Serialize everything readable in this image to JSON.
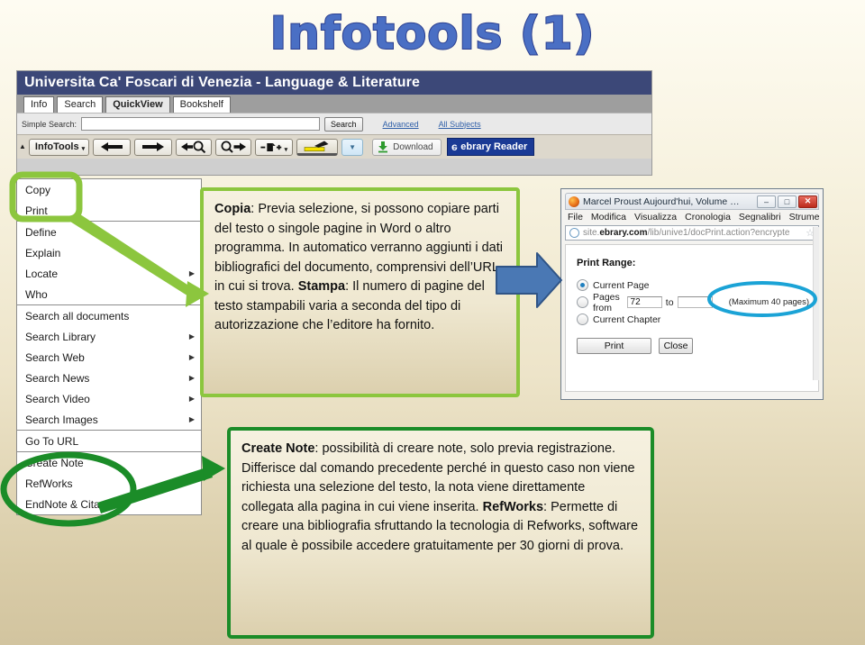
{
  "slide": {
    "title": "Infotools  (1)"
  },
  "ebrary": {
    "header_title": "Universita Ca' Foscari di Venezia - Language & Literature",
    "tabs": [
      {
        "label": "Info",
        "active": false
      },
      {
        "label": "Search",
        "active": false
      },
      {
        "label": "QuickView",
        "active": true
      },
      {
        "label": "Bookshelf",
        "active": false
      }
    ],
    "search": {
      "label": "Simple Search:",
      "value": "",
      "placeholder": "",
      "button_label": "Search",
      "links": [
        "Advanced",
        "All Subjects"
      ]
    },
    "toolbar": {
      "infotools_label": "InfoTools",
      "infotools_caret": "▾",
      "back_arrow": "←",
      "forward_arrow": "→",
      "zoom_out_label": "zoom-out",
      "zoom_in_label": "zoom-in",
      "page_size_label": "– ▤ +",
      "page_size_caret": "▾",
      "highlighter_label": "highlighter",
      "filter_caret": "▼",
      "download_label": "Download",
      "reader_label": "ebrary Reader",
      "reader_glyph": "ə"
    }
  },
  "infotools_menu": {
    "groups": [
      {
        "items": [
          {
            "label": "Copy",
            "submenu": false
          },
          {
            "label": "Print",
            "submenu": false
          }
        ]
      },
      {
        "items": [
          {
            "label": "Define",
            "submenu": false
          },
          {
            "label": "Explain",
            "submenu": false
          },
          {
            "label": "Locate",
            "submenu": true
          },
          {
            "label": "Who",
            "submenu": true
          }
        ]
      },
      {
        "items": [
          {
            "label": "Search all documents",
            "submenu": false
          },
          {
            "label": "Search Library",
            "submenu": true
          },
          {
            "label": "Search Web",
            "submenu": true
          },
          {
            "label": "Search News",
            "submenu": true
          },
          {
            "label": "Search Video",
            "submenu": true
          },
          {
            "label": "Search Images",
            "submenu": true
          }
        ]
      },
      {
        "items": [
          {
            "label": "Go To URL",
            "submenu": false
          }
        ]
      },
      {
        "items": [
          {
            "label": "Create Note",
            "submenu": false
          },
          {
            "label": "RefWorks",
            "submenu": false
          },
          {
            "label": "EndNote & Citavi",
            "submenu": false
          }
        ]
      }
    ],
    "submenu_arrow": "▶"
  },
  "callouts": {
    "copy_print": {
      "term1": "Copia",
      "text1": ": Previa selezione, si possono copiare parti del testo o singole pagine in Word o altro programma. In automatico verranno aggiunti i dati bibliografici del documento, comprensivi dell’URL in cui si trova.",
      "term2": "Stampa",
      "text2": ":  Il numero di pagine del testo stampabili varia a seconda del tipo di autorizzazione che l’editore ha fornito."
    },
    "note_refworks": {
      "term1": "Create Note",
      "text1": ": possibilità di creare note, solo previa registrazione. Differisce dal comando precedente perché in questo caso non viene richiesta una selezione del testo, la nota viene direttamente collegata alla pagina in cui viene inserita.",
      "term2": "RefWorks",
      "text2": ": Permette di creare una bibliografia sfruttando la tecnologia di Refworks, software al quale è possibile accedere gratuitamente per 30 giorni di prova."
    }
  },
  "print_window": {
    "title": "Marcel Proust Aujourd'hui, Volume …",
    "minimize_label": "–",
    "maximize_label": "□",
    "close_label": "✕",
    "menus": [
      "File",
      "Modifica",
      "Visualizza",
      "Cronologia",
      "Segnalibri",
      "Strume"
    ],
    "url_prefix": "site.",
    "url_domain": "ebrary.com",
    "url_suffix": "/lib/unive1/docPrint.action?encrypte",
    "star_glyph": "☆",
    "print_range_label": "Print Range:",
    "options": [
      {
        "label": "Current Page",
        "selected": true
      },
      {
        "label": "Pages from",
        "selected": false
      },
      {
        "label": "Current Chapter",
        "selected": false
      }
    ],
    "pages_from_value": "72",
    "pages_to_label": "to",
    "pages_to_value": "",
    "max_pages_note": "(Maximum 40 pages)",
    "print_button": "Print",
    "close_button": "Close"
  },
  "annotations": {
    "highlight_color_light_green": "#8CC63E",
    "highlight_color_dark_green": "#1B8C28",
    "arrow_color_blue": "#4A78B4",
    "circle_color_cyan": "#1BA3D6"
  }
}
